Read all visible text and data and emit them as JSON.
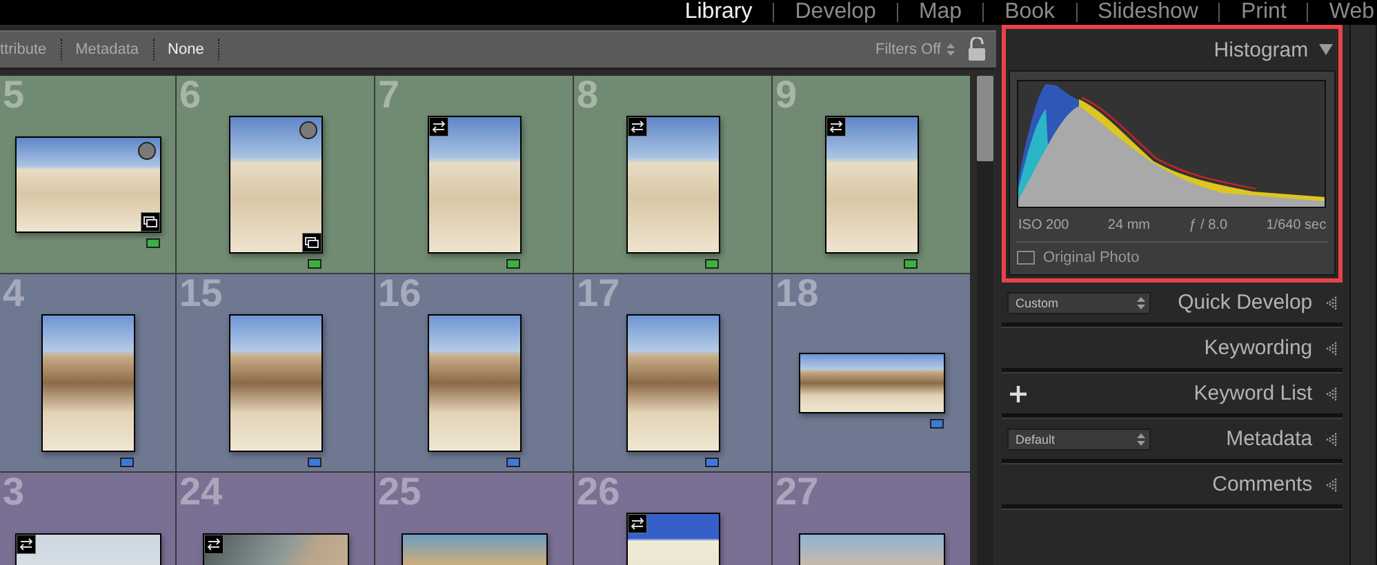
{
  "module_bar": {
    "modules": [
      {
        "label": "Library",
        "selected": true
      },
      {
        "label": "Develop",
        "selected": false
      },
      {
        "label": "Map",
        "selected": false
      },
      {
        "label": "Book",
        "selected": false
      },
      {
        "label": "Slideshow",
        "selected": false
      },
      {
        "label": "Print",
        "selected": false
      },
      {
        "label": "Web",
        "selected": false
      }
    ]
  },
  "filter_bar": {
    "items": [
      {
        "label": "ttribute",
        "selected": false
      },
      {
        "label": "Metadata",
        "selected": false
      },
      {
        "label": "None",
        "selected": true
      }
    ],
    "status": "Filters Off",
    "locked": false
  },
  "grid": {
    "rows": [
      {
        "color": "#718a72",
        "cells": [
          {
            "number": "5",
            "kind": "landscape",
            "dot": true,
            "stacked": true,
            "edited": false,
            "color": "#3cb043"
          },
          {
            "number": "6",
            "kind": "portrait",
            "dot": true,
            "stacked": true,
            "edited": false,
            "color": "#3cb043"
          },
          {
            "number": "7",
            "kind": "portrait",
            "dot": false,
            "stacked": false,
            "edited": true,
            "color": "#3cb043"
          },
          {
            "number": "8",
            "kind": "portrait",
            "dot": false,
            "stacked": false,
            "edited": true,
            "color": "#3cb043"
          },
          {
            "number": "9",
            "kind": "portrait",
            "dot": false,
            "stacked": false,
            "edited": true,
            "color": "#3cb043"
          }
        ]
      },
      {
        "color": "#6f7891",
        "cells": [
          {
            "number": "4",
            "kind": "portrait",
            "dot": false,
            "stacked": false,
            "edited": false,
            "color": "#3f78db"
          },
          {
            "number": "15",
            "kind": "portrait",
            "dot": false,
            "stacked": false,
            "edited": false,
            "color": "#3f78db"
          },
          {
            "number": "16",
            "kind": "portrait",
            "dot": false,
            "stacked": false,
            "edited": false,
            "color": "#3f78db"
          },
          {
            "number": "17",
            "kind": "portrait",
            "dot": false,
            "stacked": false,
            "edited": false,
            "color": "#3f78db"
          },
          {
            "number": "18",
            "kind": "panorama",
            "dot": false,
            "stacked": false,
            "edited": false,
            "color": "#3f78db"
          }
        ]
      },
      {
        "color": "#7a7094",
        "cells": [
          {
            "number": "3",
            "kind": "landscape",
            "dot": false,
            "edited": true
          },
          {
            "number": "24",
            "kind": "landscape",
            "dot": false,
            "edited": true
          },
          {
            "number": "25",
            "kind": "landscape",
            "dot": false,
            "edited": false
          },
          {
            "number": "26",
            "kind": "portrait",
            "dot": false,
            "edited": true
          },
          {
            "number": "27",
            "kind": "landscape",
            "dot": false,
            "edited": false
          }
        ]
      }
    ]
  },
  "right_panel": {
    "histogram": {
      "title": "Histogram",
      "highlighted": true,
      "expanded": true,
      "exif": [
        "ISO 200",
        "24 mm",
        "ƒ / 8.0",
        "1/640 sec"
      ],
      "original_photo": {
        "label": "Original Photo",
        "checked": false
      }
    },
    "sections": [
      {
        "title": "Quick Develop",
        "kind": "select",
        "value": "Custom",
        "expanded": false
      },
      {
        "title": "Keywording",
        "kind": "plain",
        "expanded": false
      },
      {
        "title": "Keyword List",
        "kind": "add",
        "expanded": false
      },
      {
        "title": "Metadata",
        "kind": "select",
        "value": "Default",
        "expanded": false
      },
      {
        "title": "Comments",
        "kind": "plain",
        "expanded": false
      }
    ]
  }
}
